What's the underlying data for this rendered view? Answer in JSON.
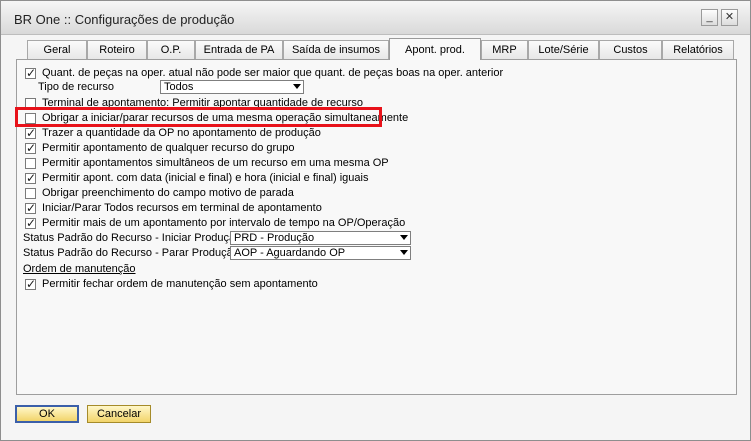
{
  "window": {
    "title": "BR One :: Configurações de produção"
  },
  "tabs": [
    {
      "label": "Geral"
    },
    {
      "label": "Roteiro"
    },
    {
      "label": "O.P."
    },
    {
      "label": "Entrada de PA"
    },
    {
      "label": "Saída de insumos"
    },
    {
      "label": "Apont. prod.",
      "active": true
    },
    {
      "label": "MRP"
    },
    {
      "label": "Lote/Série"
    },
    {
      "label": "Custos"
    },
    {
      "label": "Relatórios"
    }
  ],
  "options": {
    "qty_limit": {
      "label": "Quant. de peças na oper. atual não pode ser maior que quant. de peças boas na oper. anterior",
      "checked": true
    },
    "resource_type": {
      "label": "Tipo de recurso",
      "value": "Todos"
    },
    "terminal_qty": {
      "label": "Terminal de apontamento: Permitir apontar quantidade de recurso",
      "checked": false
    },
    "simultaneous_start": {
      "label": "Obrigar a iniciar/parar recursos de uma mesma operação simultaneamente",
      "checked": false
    },
    "bring_op_qty": {
      "label": "Trazer a quantidade da OP no apontamento de produção",
      "checked": true
    },
    "any_group_resource": {
      "label": "Permitir apontamento de qualquer recurso do grupo",
      "checked": true
    },
    "simultaneous_same_op": {
      "label": "Permitir apontamentos simultâneos de um recurso em uma mesma OP",
      "checked": false
    },
    "same_datetime": {
      "label": "Permitir apont. com data (inicial e final) e hora (inicial e final) iguais",
      "checked": true
    },
    "stop_reason_required": {
      "label": "Obrigar preenchimento do campo motivo de parada",
      "checked": false
    },
    "start_stop_all": {
      "label": "Iniciar/Parar Todos recursos em terminal de apontamento",
      "checked": true
    },
    "multiple_per_interval": {
      "label": "Permitir mais de um apontamento por intervalo de tempo na OP/Operação",
      "checked": true
    }
  },
  "status": {
    "start": {
      "label": "Status Padrão do Recurso - Iniciar Produção",
      "value": "PRD - Produção"
    },
    "stop": {
      "label": "Status Padrão do Recurso - Parar Produção",
      "value": "AOP - Aguardando OP"
    }
  },
  "maintenance": {
    "section_label": "Ordem de manutenção",
    "close_without": {
      "label": "Permitir fechar ordem de manutenção sem apontamento",
      "checked": true
    }
  },
  "buttons": {
    "ok": "OK",
    "cancel": "Cancelar"
  },
  "colors": {
    "highlight": "#e8121a",
    "button_yellow": "#f2d46a"
  }
}
